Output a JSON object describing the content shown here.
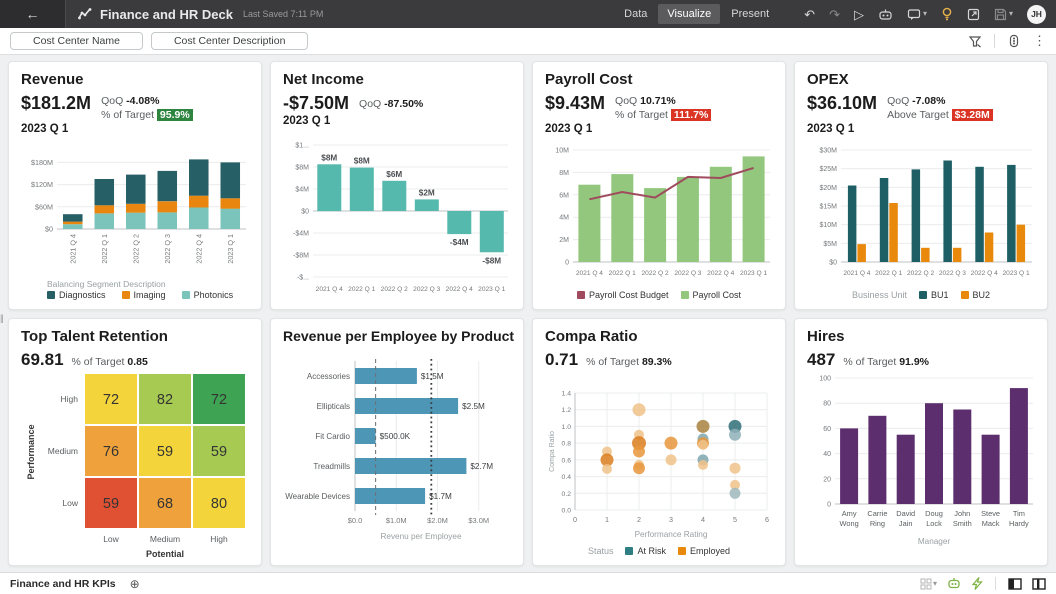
{
  "colors": {
    "badge_green": "#2E8540",
    "badge_red": "#DA3425",
    "header_bg": "#3b3b3d",
    "canvas_bg": "#eef0f1",
    "bulb_yellow": "#E8B34B",
    "footer_green": "#7CB342"
  },
  "header": {
    "back": "←",
    "title": "Finance and HR Deck",
    "saved": "Last Saved 7:11 PM",
    "tabs": [
      {
        "label": "Data"
      },
      {
        "label": "Visualize"
      },
      {
        "label": "Present"
      }
    ],
    "avatar": "JH"
  },
  "toolbar": {
    "pills": {
      "0": "Cost Center Name",
      "1": "Cost Center Description"
    }
  },
  "cards": {
    "revenue": {
      "title": "Revenue",
      "value": "$181.2M",
      "qoq_label": "QoQ",
      "qoq": "-4.08%",
      "target_label": "% of Target",
      "target": "95.9%",
      "period": "2023 Q 1"
    },
    "net_income": {
      "title": "Net Income",
      "value": "-$7.50M",
      "qoq_label": "QoQ",
      "qoq": "-87.50%",
      "period": "2023 Q 1"
    },
    "payroll": {
      "title": "Payroll Cost",
      "value": "$9.43M",
      "qoq_label": "QoQ",
      "qoq": "10.71%",
      "target_label": "% of Target",
      "target": "111.7%",
      "period": "2023 Q 1"
    },
    "opex": {
      "title": "OPEX",
      "value": "$36.10M",
      "qoq_label": "QoQ",
      "qoq": "-7.08%",
      "target_label": "Above Target",
      "target": "$3.28M",
      "period": "2023 Q 1"
    },
    "retention": {
      "title": "Top Talent Retention",
      "value": "69.81",
      "target_label": "% of Target",
      "target": "0.85"
    },
    "rev_per_emp": {
      "title": "Revenue per Employee by Product"
    },
    "compa": {
      "title": "Compa Ratio",
      "value": "0.71",
      "target_label": "% of Target",
      "target": "89.3%"
    },
    "hires": {
      "title": "Hires",
      "value": "487",
      "target_label": "% of Target",
      "target": "91.9%"
    }
  },
  "footer": {
    "tab": "Finance and HR KPIs"
  },
  "chart_data": [
    {
      "id": "revenue",
      "type": "stacked_bar",
      "title": "Revenue",
      "categories": [
        "2021 Q 4",
        "2022 Q 1",
        "2022 Q 2",
        "2022 Q 3",
        "2022 Q 4",
        "2023 Q 1"
      ],
      "series": [
        {
          "name": "Photonics",
          "color": "#7AC4BC",
          "values": [
            13,
            42,
            44,
            45,
            58,
            55
          ]
        },
        {
          "name": "Imaging",
          "color": "#E8860F",
          "values": [
            7,
            22,
            24,
            30,
            32,
            28
          ]
        },
        {
          "name": "Diagnostics",
          "color": "#265F66",
          "values": [
            20,
            71,
            79,
            82,
            98,
            97
          ]
        }
      ],
      "ymax": 200,
      "yticks": [
        {
          "v": 0,
          "label": "$0"
        },
        {
          "v": 60,
          "label": "$60M"
        },
        {
          "v": 120,
          "label": "$120M"
        },
        {
          "v": 180,
          "label": "$180M"
        }
      ],
      "legend_title": "Balancing Segment Description",
      "legend_layout": "stacked",
      "legend": [
        {
          "label": "Diagnostics",
          "color": "#265F66"
        },
        {
          "label": "Imaging",
          "color": "#E8860F"
        },
        {
          "label": "Photonics",
          "color": "#7AC4BC"
        }
      ]
    },
    {
      "id": "net_income",
      "type": "bar",
      "title": "Net Income",
      "categories": [
        "2021 Q 4",
        "2022 Q 1",
        "2022 Q 2",
        "2022 Q 3",
        "2022 Q 4",
        "2023 Q 1"
      ],
      "values": [
        8.5,
        7.9,
        5.5,
        2.1,
        -4.2,
        -7.5
      ],
      "labels": [
        "$8M",
        "$8M",
        "$6M",
        "$2M",
        "-$4M",
        "-$8M"
      ],
      "color": "#56B9AE",
      "ymin": -12,
      "ymax": 12,
      "yticks": [
        {
          "v": 12,
          "label": "$1..."
        },
        {
          "v": 8,
          "label": "$8M"
        },
        {
          "v": 4,
          "label": "$4M"
        },
        {
          "v": 0,
          "label": "$0"
        },
        {
          "v": -4,
          "label": "-$4M"
        },
        {
          "v": -8,
          "label": "-$8M"
        },
        {
          "v": -12,
          "label": "-$..."
        }
      ]
    },
    {
      "id": "payroll",
      "type": "combo",
      "title": "Payroll Cost",
      "categories": [
        "2021 Q 4",
        "2022 Q 1",
        "2022 Q 2",
        "2022 Q 3",
        "2022 Q 4",
        "2023 Q 1"
      ],
      "bars": {
        "name": "Payroll Cost",
        "color": "#92C77D",
        "values": [
          6.9,
          7.85,
          6.6,
          7.6,
          8.5,
          9.43
        ]
      },
      "line": {
        "name": "Payroll Cost Budget",
        "color": "#A04A5E",
        "values": [
          5.6,
          6.25,
          5.75,
          7.6,
          7.5,
          8.4
        ]
      },
      "ymax": 10,
      "yticks": [
        {
          "v": 0,
          "label": "0"
        },
        {
          "v": 2,
          "label": "2M"
        },
        {
          "v": 4,
          "label": "4M"
        },
        {
          "v": 6,
          "label": "6M"
        },
        {
          "v": 8,
          "label": "8M"
        },
        {
          "v": 10,
          "label": "10M"
        }
      ],
      "legend": [
        {
          "label": "Payroll Cost Budget",
          "color": "#A04A5E"
        },
        {
          "label": "Payroll Cost",
          "color": "#92C77D"
        }
      ]
    },
    {
      "id": "opex",
      "type": "grouped_bar",
      "title": "OPEX",
      "categories": [
        "2021 Q 4",
        "2022 Q 1",
        "2022 Q 2",
        "2022 Q 3",
        "2022 Q 4",
        "2023 Q 1"
      ],
      "series": [
        {
          "name": "BU1",
          "color": "#1E5F66",
          "values": [
            20.5,
            22.5,
            24.8,
            27.2,
            25.5,
            26
          ]
        },
        {
          "name": "BU2",
          "color": "#E8890C",
          "values": [
            4.8,
            15.8,
            3.8,
            3.8,
            7.9,
            10
          ]
        }
      ],
      "ymax": 30,
      "yticks": [
        {
          "v": 0,
          "label": "$0"
        },
        {
          "v": 5,
          "label": "$5M"
        },
        {
          "v": 10,
          "label": "$10M"
        },
        {
          "v": 15,
          "label": "$15M"
        },
        {
          "v": 20,
          "label": "$20M"
        },
        {
          "v": 25,
          "label": "$25M"
        },
        {
          "v": 30,
          "label": "$30M"
        }
      ],
      "legend_title": "Business Unit",
      "legend": [
        {
          "label": "BU1",
          "color": "#1E5F66"
        },
        {
          "label": "BU2",
          "color": "#E8890C"
        }
      ]
    },
    {
      "id": "retention",
      "type": "heatmap",
      "title": "Top Talent Retention",
      "row_axis": "Performance",
      "col_axis": "Potential",
      "rows": [
        "High",
        "Medium",
        "Low"
      ],
      "cols": [
        "Low",
        "Medium",
        "High"
      ],
      "cells": [
        [
          {
            "v": 72,
            "c": "#F3D53B"
          },
          {
            "v": 82,
            "c": "#A7CA53"
          },
          {
            "v": 72,
            "c": "#3EA353"
          }
        ],
        [
          {
            "v": 76,
            "c": "#EFA23B"
          },
          {
            "v": 59,
            "c": "#F3D53B"
          },
          {
            "v": 59,
            "c": "#A7CA53"
          }
        ],
        [
          {
            "v": 59,
            "c": "#E05032"
          },
          {
            "v": 68,
            "c": "#EFA23B"
          },
          {
            "v": 80,
            "c": "#F3D53B"
          }
        ]
      ]
    },
    {
      "id": "rev_per_employee",
      "type": "hbar",
      "title": "Revenue per Employee by Product",
      "categories": [
        "Accessories",
        "Ellipticals",
        "Fit Cardio",
        "Treadmills",
        "Wearable Devices"
      ],
      "values": [
        1.5,
        2.5,
        0.5,
        2.7,
        1.7
      ],
      "labels": [
        "$1.5M",
        "$2.5M",
        "$500.0K",
        "$2.7M",
        "$1.7M"
      ],
      "color": "#4D96B5",
      "xmax": 3.2,
      "xticks": [
        {
          "v": 0,
          "label": "$0.0"
        },
        {
          "v": 1,
          "label": "$1.0M"
        },
        {
          "v": 2,
          "label": "$2.0M"
        },
        {
          "v": 3,
          "label": "$3.0M"
        }
      ],
      "ref_dashed": 0.5,
      "ref_dotted": 1.85,
      "xlabel": "Revenu per Employee"
    },
    {
      "id": "compa_ratio",
      "type": "scatter",
      "title": "Compa Ratio",
      "xlabel": "Performance Rating",
      "ylabel": "Compa Ratio",
      "xmax": 6,
      "ymax": 1.4,
      "xticks": [
        {
          "v": 0,
          "label": "0"
        },
        {
          "v": 1,
          "label": "1"
        },
        {
          "v": 2,
          "label": "2"
        },
        {
          "v": 3,
          "label": "3"
        },
        {
          "v": 4,
          "label": "4"
        },
        {
          "v": 5,
          "label": "5"
        },
        {
          "v": 6,
          "label": "6"
        }
      ],
      "yticks": [
        {
          "v": 0,
          "label": "0.0"
        },
        {
          "v": 0.2,
          "label": "0.2"
        },
        {
          "v": 0.4,
          "label": "0.4"
        },
        {
          "v": 0.6,
          "label": "0.6"
        },
        {
          "v": 0.8,
          "label": "0.8"
        },
        {
          "v": 1.0,
          "label": "1.0"
        },
        {
          "v": 1.2,
          "label": "1.2"
        },
        {
          "v": 1.4,
          "label": "1.4"
        }
      ],
      "points": [
        {
          "x": 1,
          "y": 0.7,
          "c": "#F0C289",
          "r": 5
        },
        {
          "x": 1,
          "y": 0.6,
          "c": "#DA7E1E",
          "r": 6.5
        },
        {
          "x": 1,
          "y": 0.49,
          "c": "#F0C289",
          "r": 5
        },
        {
          "x": 2,
          "y": 1.2,
          "c": "#F0C289",
          "r": 6.5
        },
        {
          "x": 2,
          "y": 0.9,
          "c": "#F0C289",
          "r": 5
        },
        {
          "x": 2,
          "y": 0.8,
          "c": "#DA7E1E",
          "r": 7
        },
        {
          "x": 2,
          "y": 0.7,
          "c": "#E8963C",
          "r": 6
        },
        {
          "x": 2,
          "y": 0.54,
          "c": "#F0C289",
          "r": 5
        },
        {
          "x": 2,
          "y": 0.5,
          "c": "#E8963C",
          "r": 6
        },
        {
          "x": 3,
          "y": 0.8,
          "c": "#E8963C",
          "r": 6.5
        },
        {
          "x": 3,
          "y": 0.6,
          "c": "#F0C289",
          "r": 5.5
        },
        {
          "x": 4,
          "y": 1.0,
          "c": "#A8823F",
          "r": 6.5
        },
        {
          "x": 4,
          "y": 0.85,
          "c": "#7FA6AE",
          "r": 5.5
        },
        {
          "x": 4,
          "y": 0.8,
          "c": "#E8963C",
          "r": 6
        },
        {
          "x": 4,
          "y": 0.78,
          "c": "#F0C289",
          "r": 5
        },
        {
          "x": 4,
          "y": 0.6,
          "c": "#7FA6AE",
          "r": 5.5
        },
        {
          "x": 4,
          "y": 0.54,
          "c": "#F0C289",
          "r": 5
        },
        {
          "x": 5,
          "y": 1.0,
          "c": "#2F6F78",
          "r": 6.5
        },
        {
          "x": 5,
          "y": 0.9,
          "c": "#8FB0B8",
          "r": 6
        },
        {
          "x": 5,
          "y": 0.5,
          "c": "#F0C289",
          "r": 5.5
        },
        {
          "x": 5,
          "y": 0.3,
          "c": "#F0C289",
          "r": 5
        },
        {
          "x": 5,
          "y": 0.2,
          "c": "#9FB8BC",
          "r": 5.5
        }
      ],
      "legend_title": "Status",
      "legend": [
        {
          "label": "At Risk",
          "color": "#2F7E84"
        },
        {
          "label": "Employed",
          "color": "#E8890C"
        }
      ]
    },
    {
      "id": "hires",
      "type": "bar2",
      "title": "Hires",
      "categories": [
        [
          "Amy",
          "Wong"
        ],
        [
          "Carrie",
          "Ring"
        ],
        [
          "David",
          "Jain"
        ],
        [
          "Doug",
          "Lock"
        ],
        [
          "John",
          "Smith"
        ],
        [
          "Steve",
          "Mack"
        ],
        [
          "Tim",
          "Hardy"
        ]
      ],
      "values": [
        60,
        70,
        55,
        80,
        75,
        55,
        92
      ],
      "color": "#5C2E6E",
      "ymax": 100,
      "yticks": [
        {
          "v": 0,
          "label": "0"
        },
        {
          "v": 20,
          "label": "20"
        },
        {
          "v": 40,
          "label": "40"
        },
        {
          "v": 60,
          "label": "60"
        },
        {
          "v": 80,
          "label": "80"
        },
        {
          "v": 100,
          "label": "100"
        }
      ],
      "xlabel": "Manager"
    }
  ]
}
